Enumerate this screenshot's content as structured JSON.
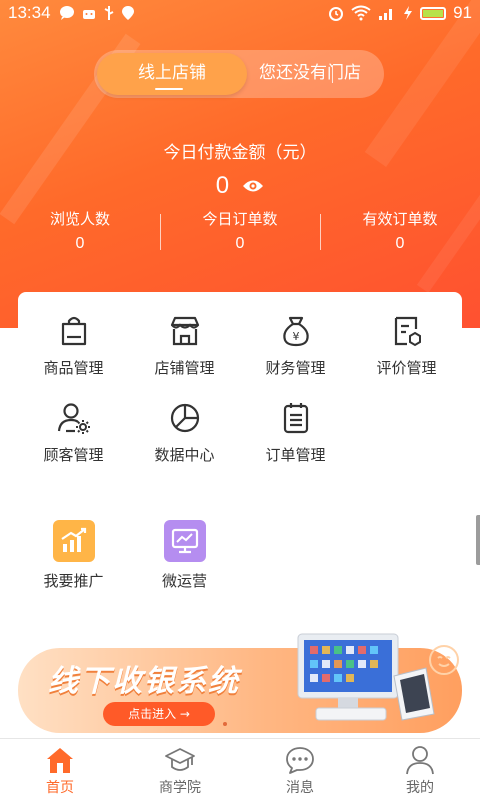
{
  "status_bar": {
    "time": "13:34",
    "battery_level": "91"
  },
  "store_switcher": {
    "online_label": "线上店铺",
    "offline_label": "您还没有门店",
    "selected": "线上店铺"
  },
  "summary": {
    "title": "今日付款金额（元）",
    "amount": "0",
    "stats": [
      {
        "label": "浏览人数",
        "value": "0"
      },
      {
        "label": "今日订单数",
        "value": "0"
      },
      {
        "label": "有效订单数",
        "value": "0"
      }
    ]
  },
  "menu": [
    {
      "label": "商品管理",
      "icon": "shopping-bag-icon"
    },
    {
      "label": "店铺管理",
      "icon": "storefront-icon"
    },
    {
      "label": "财务管理",
      "icon": "money-bag-icon"
    },
    {
      "label": "评价管理",
      "icon": "review-icon"
    },
    {
      "label": "顾客管理",
      "icon": "customer-settings-icon"
    },
    {
      "label": "数据中心",
      "icon": "pie-chart-icon"
    },
    {
      "label": "订单管理",
      "icon": "clipboard-list-icon"
    }
  ],
  "promo": [
    {
      "label": "我要推广",
      "icon": "promotion-chart-icon",
      "color": "#ffb547"
    },
    {
      "label": "微运营",
      "icon": "monitor-icon",
      "color": "#b58df0"
    }
  ],
  "banner": {
    "title": "线下收银系统",
    "button": "点击进入 →"
  },
  "tabbar": [
    {
      "label": "首页",
      "icon": "home-icon",
      "active": true
    },
    {
      "label": "商学院",
      "icon": "graduation-cap-icon",
      "active": false
    },
    {
      "label": "消息",
      "icon": "chat-bubble-icon",
      "active": false
    },
    {
      "label": "我的",
      "icon": "person-icon",
      "active": false
    }
  ],
  "colors": {
    "brand": "#ff6a2a",
    "text": "#333333"
  }
}
